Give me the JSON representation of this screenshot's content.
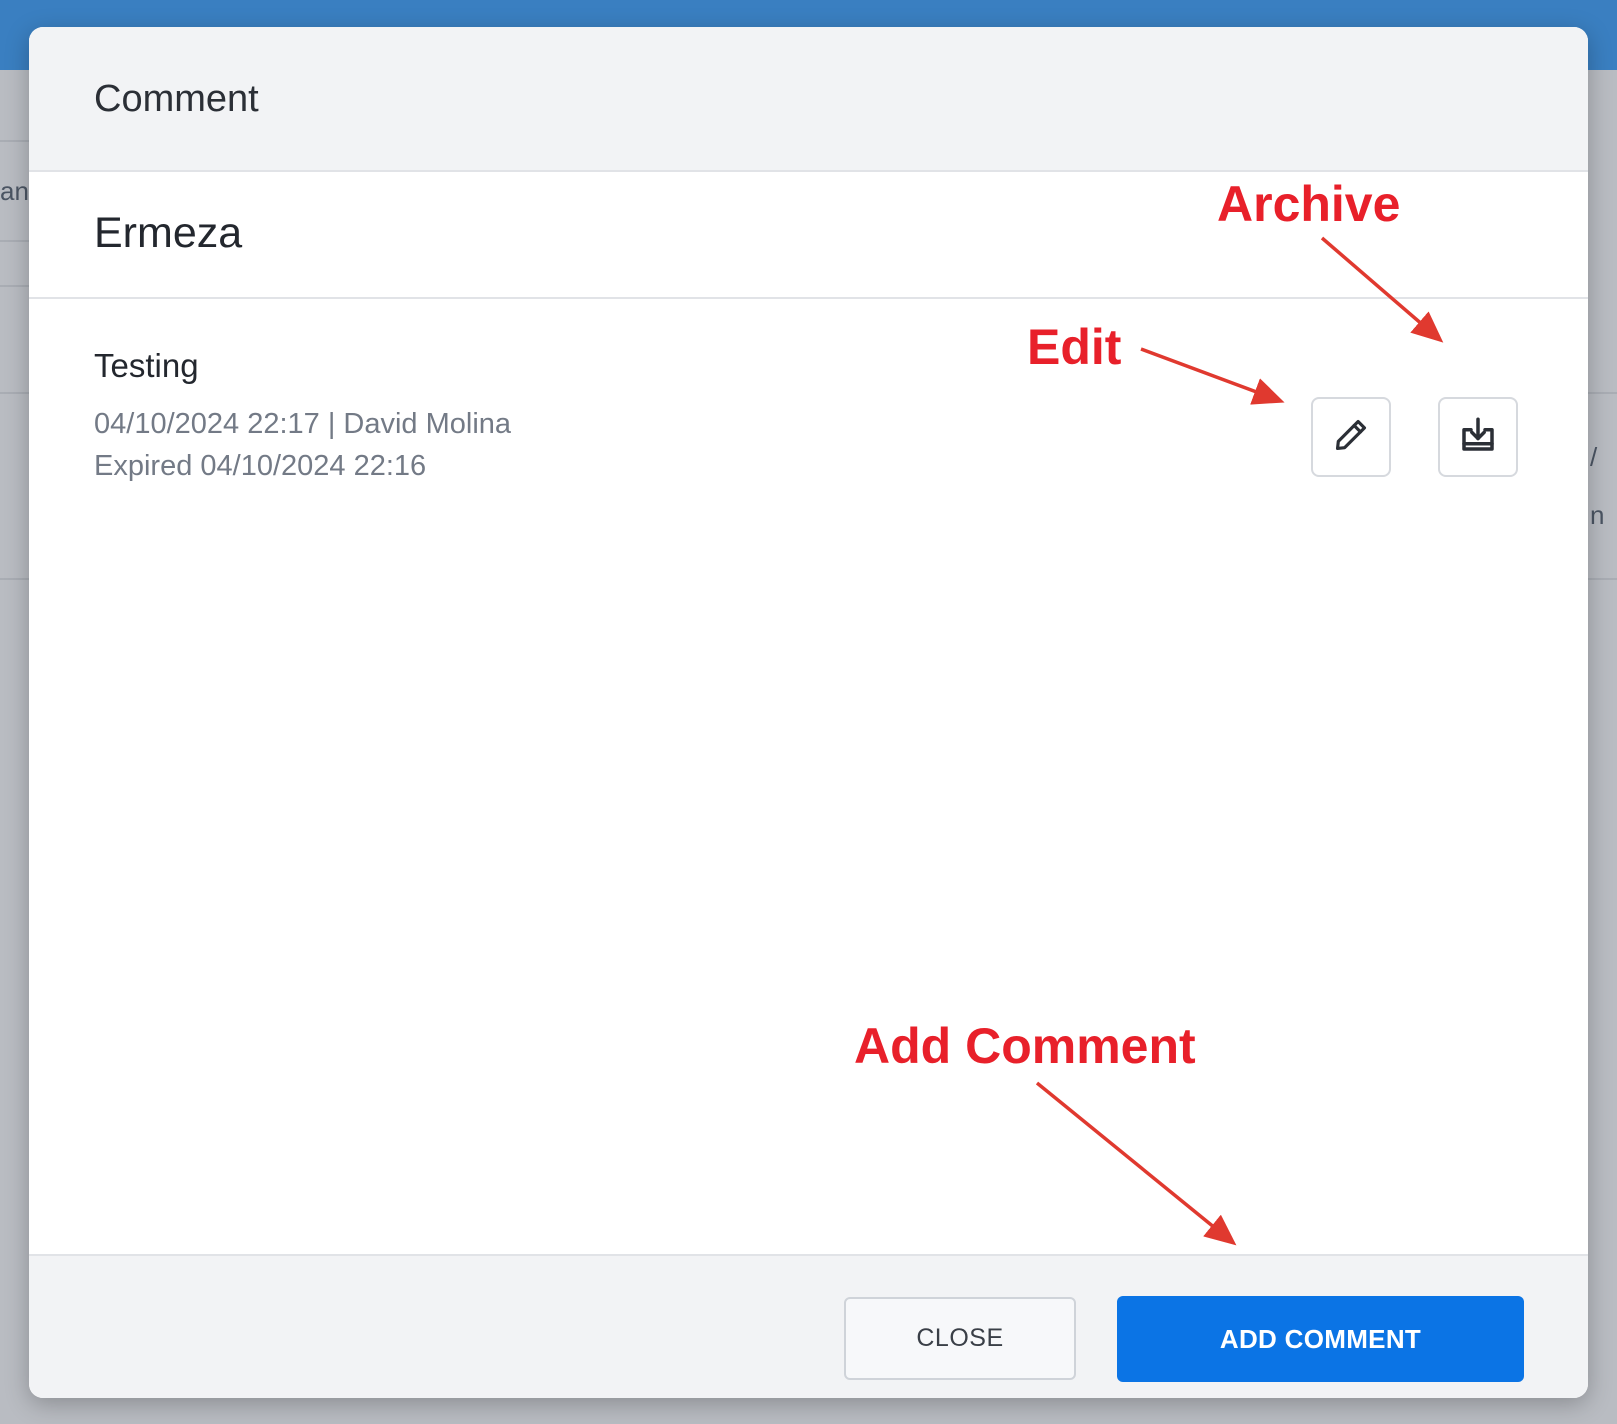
{
  "background": {
    "fragment_left": "an",
    "fragment_right_1": "/",
    "fragment_right_2": "n"
  },
  "modal": {
    "title": "Comment",
    "section_name": "Ermeza",
    "comment": {
      "text": "Testing",
      "meta_line": "04/10/2024 22:17 | David Molina",
      "expired_line": "Expired 04/10/2024 22:16"
    },
    "icons": {
      "edit": "pencil-icon",
      "archive": "archive-icon"
    },
    "footer": {
      "close_label": "CLOSE",
      "add_label": "ADD COMMENT"
    }
  },
  "annotations": {
    "archive": "Archive",
    "edit": "Edit",
    "add_comment": "Add Comment"
  },
  "colors": {
    "primary": "#0b74e5",
    "annotation": "#e8202a",
    "header_bar": "#3a7fc1"
  }
}
